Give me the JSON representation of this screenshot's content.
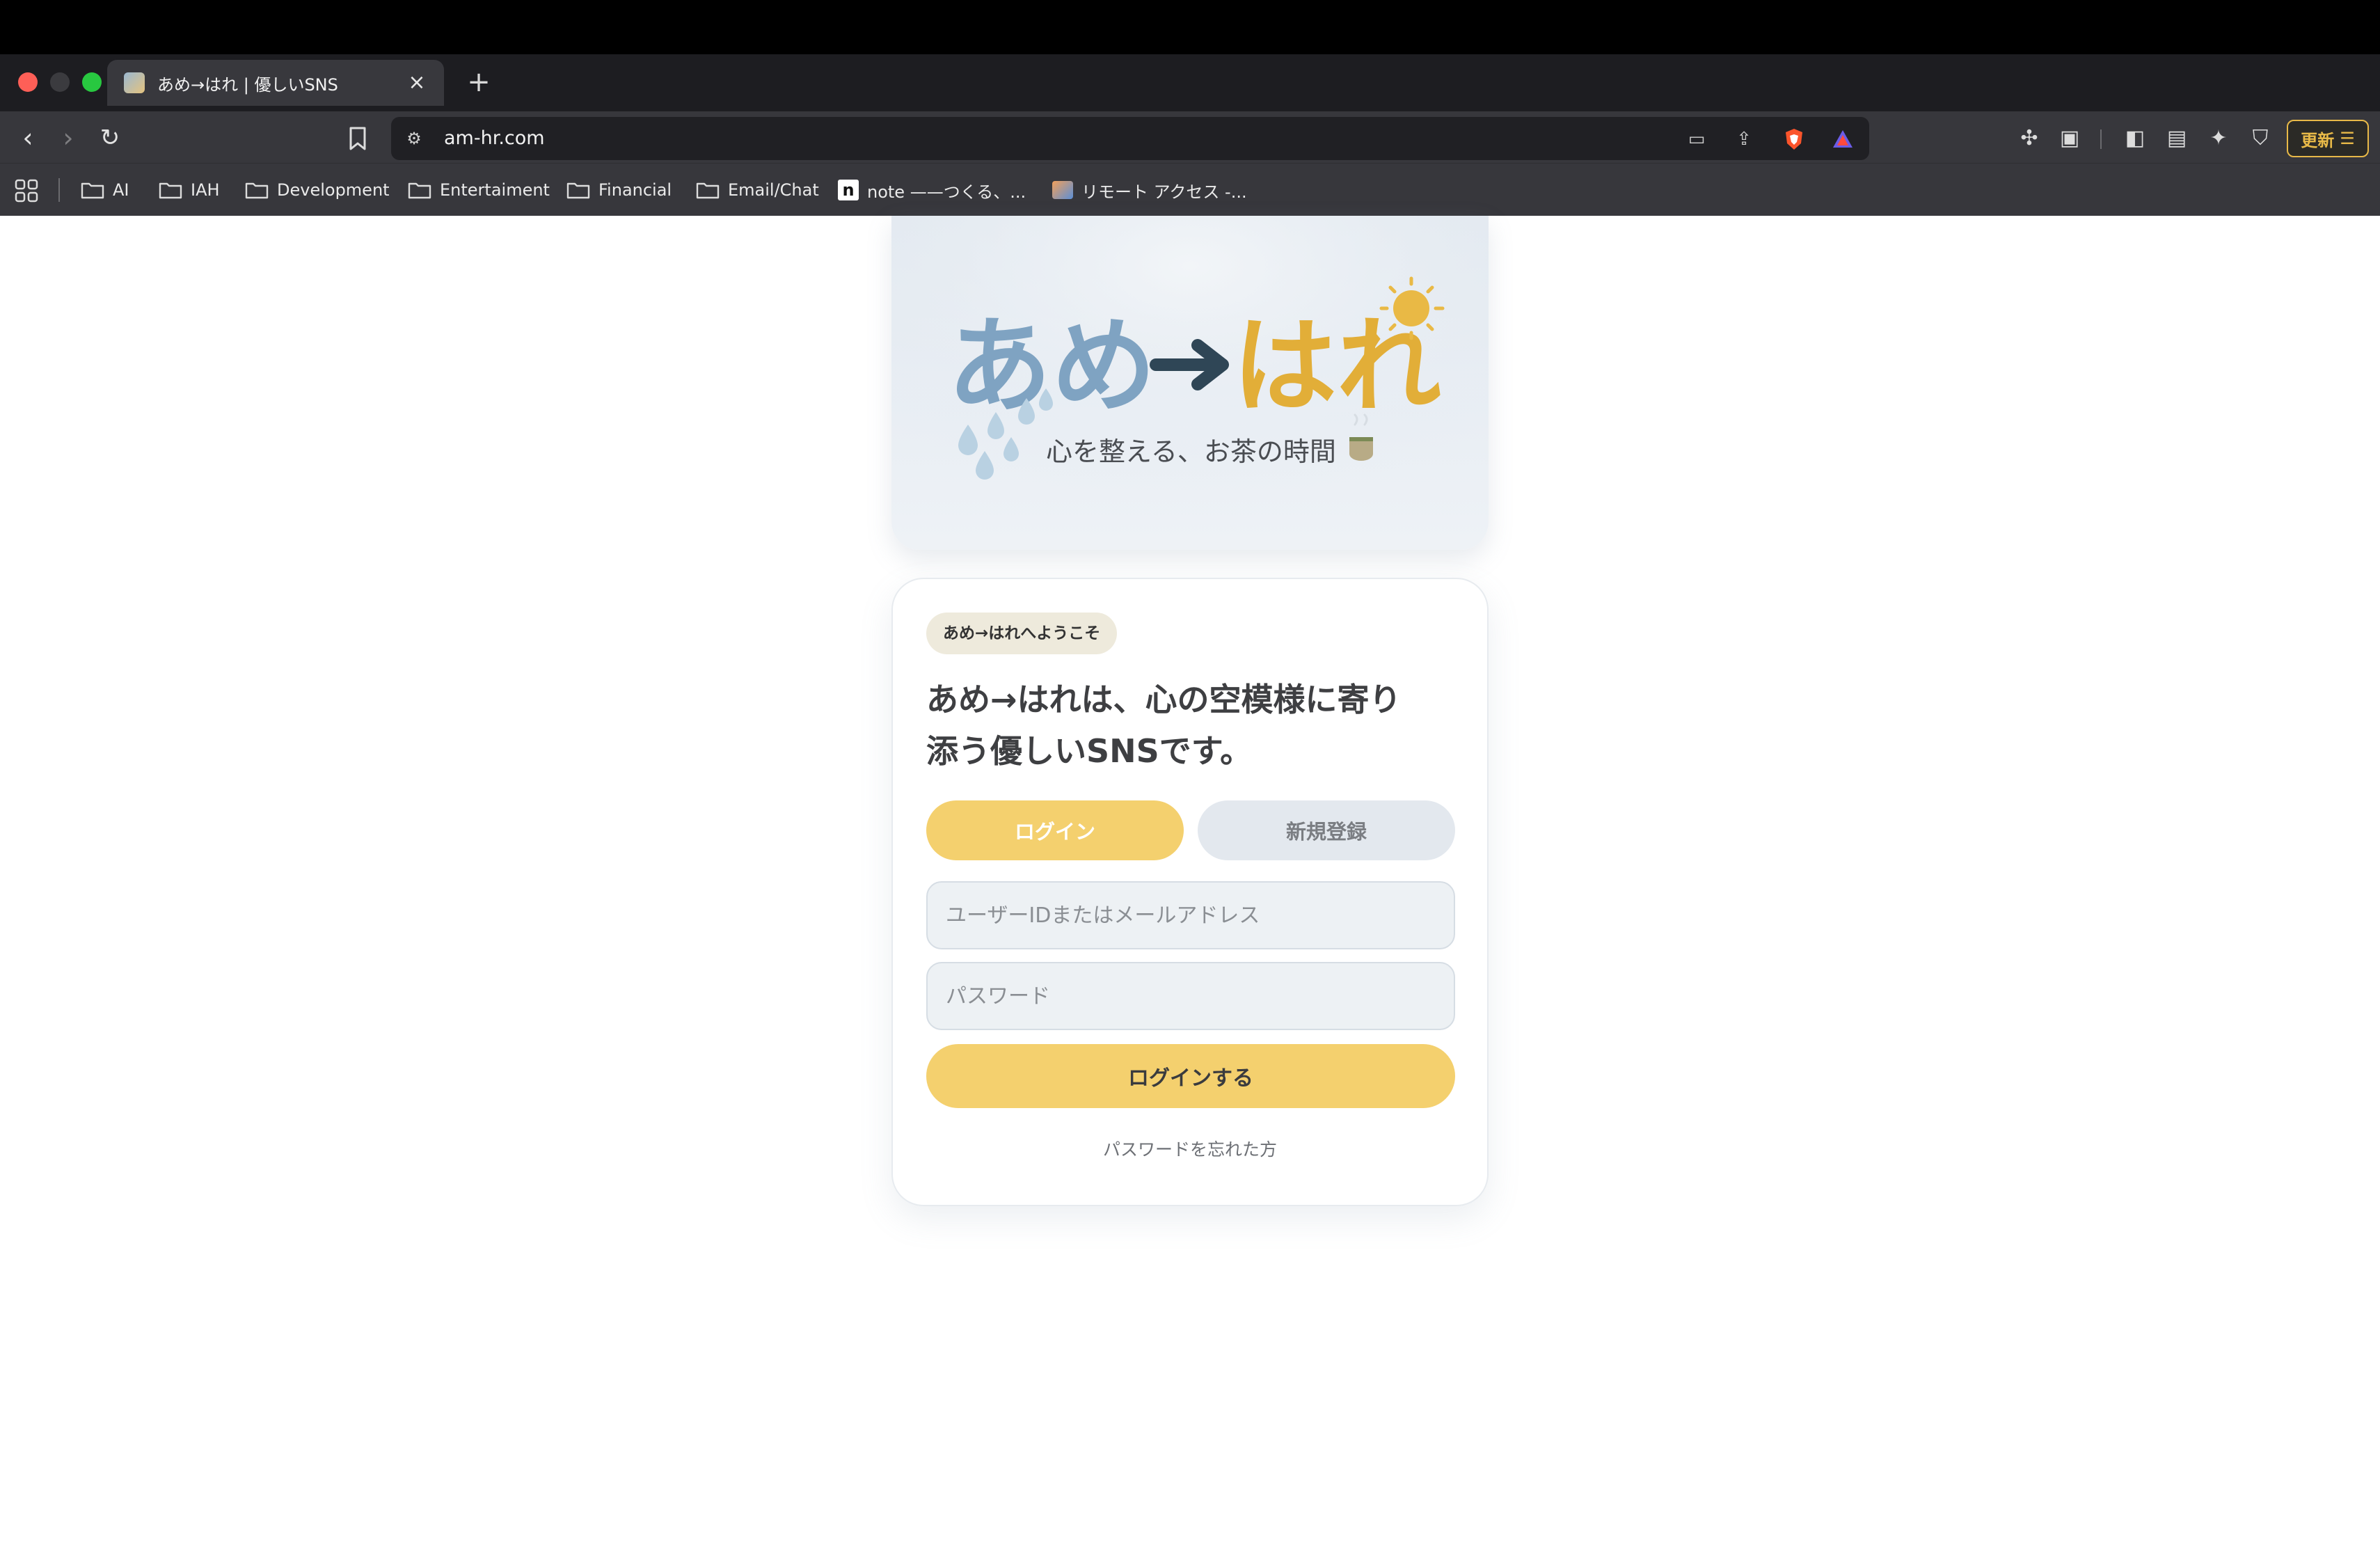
{
  "browser": {
    "tab_title": "あめ→はれ | 優しいSNS",
    "url": "am-hr.com",
    "update_label": "更新",
    "bookmarks": [
      {
        "label": "AI",
        "type": "folder"
      },
      {
        "label": "IAH",
        "type": "folder"
      },
      {
        "label": "Development",
        "type": "folder"
      },
      {
        "label": "Entertaiment",
        "type": "folder"
      },
      {
        "label": "Financial",
        "type": "folder"
      },
      {
        "label": "Email/Chat",
        "type": "folder"
      },
      {
        "label": "note ——つくる、...",
        "type": "site"
      },
      {
        "label": "リモート アクセス -...",
        "type": "site"
      }
    ]
  },
  "hero": {
    "logo_left": "あめ",
    "logo_right": "はれ",
    "tagline": "心を整える、お茶の時間"
  },
  "card": {
    "badge": "あめ→はれへようこそ",
    "heading_line1": "あめ→はれは、心の空模様に寄り",
    "heading_line2": "添う優しいSNSです。",
    "tab_login": "ログイン",
    "tab_signup": "新規登録",
    "user_placeholder": "ユーザーIDまたはメールアドレス",
    "password_placeholder": "パスワード",
    "submit_label": "ログインする",
    "forgot_label": "パスワードを忘れた方"
  },
  "colors": {
    "accent_yellow": "#f4d06e",
    "logo_blue": "#7fa3c2",
    "logo_gold": "#e2ae38",
    "arrow_dark": "#2f4656"
  }
}
